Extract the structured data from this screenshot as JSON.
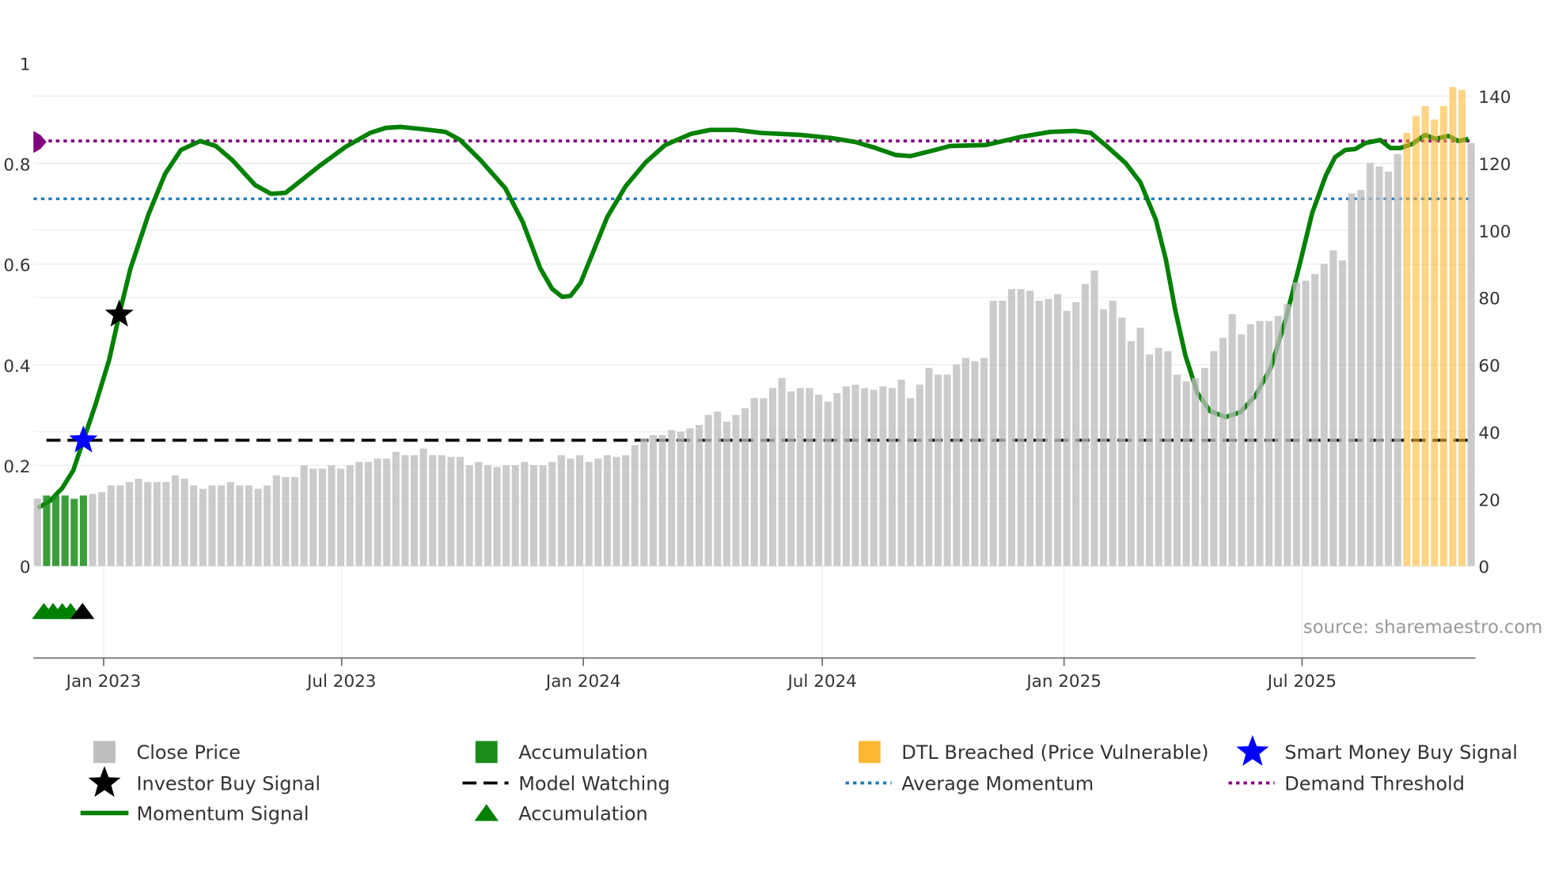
{
  "chart_data": {
    "type": "bar+line",
    "title": "",
    "x_unit": "week index",
    "x_ticks": [
      {
        "label": "Jan 2023",
        "week": 7.2
      },
      {
        "label": "Jul 2023",
        "week": 33.1
      },
      {
        "label": "Jan 2024",
        "week": 59.4
      },
      {
        "label": "Jul 2024",
        "week": 85.4
      },
      {
        "label": "Jan 2025",
        "week": 111.7
      },
      {
        "label": "Jul 2025",
        "week": 137.6
      }
    ],
    "left_axis": {
      "ylim": [
        0,
        1
      ],
      "ticks": [
        "0",
        "0.2",
        "0.4",
        "0.6",
        "0.8",
        "1"
      ]
    },
    "right_axis": {
      "ylim": [
        0,
        140
      ],
      "ticks": [
        "0",
        "20",
        "40",
        "60",
        "80",
        "100",
        "120",
        "140"
      ]
    },
    "close_price": [
      20,
      21,
      21,
      21,
      20,
      21,
      21.5,
      22,
      24,
      24,
      25,
      26,
      25,
      25,
      25,
      27,
      26,
      24,
      23,
      24,
      24,
      25,
      24,
      24,
      23,
      24,
      27,
      26.5,
      26.5,
      30,
      29,
      29,
      30,
      29,
      30,
      31,
      31,
      32,
      32,
      34,
      33,
      33,
      35,
      33,
      33,
      32.5,
      32.5,
      30,
      31,
      30,
      29.5,
      30,
      30,
      31,
      30,
      30,
      31,
      33,
      32,
      33,
      31,
      32,
      33,
      32.5,
      33,
      36,
      38,
      39,
      39,
      40.5,
      40,
      41,
      42,
      45,
      46,
      43,
      45,
      47,
      50,
      50,
      53,
      56,
      52,
      53,
      53,
      51,
      49,
      51.5,
      53.5,
      54,
      53,
      52.5,
      53.5,
      53,
      55.5,
      50,
      54,
      59,
      57,
      57,
      60,
      62,
      61,
      62,
      79,
      79,
      82.5,
      82.5,
      82,
      79,
      79.5,
      81,
      76,
      78.6,
      84,
      88,
      76.5,
      79,
      74,
      67,
      71,
      63,
      65,
      64,
      57,
      55,
      56,
      59,
      64,
      68,
      75,
      69,
      72,
      73,
      73,
      74.5,
      78,
      84.5,
      85,
      87,
      90,
      94,
      91,
      111,
      112,
      120,
      119,
      117.5,
      122.7,
      129,
      134,
      137,
      133,
      137,
      142.7,
      141.8,
      126
    ],
    "accumulation_bar_weeks": [
      1,
      2,
      3,
      4,
      5
    ],
    "dtl_breached_weeks": [
      149,
      150,
      151,
      152,
      153,
      154,
      155
    ],
    "momentum_signal": [
      [
        0,
        0.115
      ],
      [
        1.4,
        0.13
      ],
      [
        2.7,
        0.155
      ],
      [
        3.9,
        0.19
      ],
      [
        5.0,
        0.25
      ],
      [
        6.3,
        0.32
      ],
      [
        7.8,
        0.41
      ],
      [
        8.9,
        0.5
      ],
      [
        10.1,
        0.59
      ],
      [
        12.1,
        0.7
      ],
      [
        13.9,
        0.78
      ],
      [
        15.6,
        0.827
      ],
      [
        17.7,
        0.845
      ],
      [
        19.4,
        0.835
      ],
      [
        21.2,
        0.807
      ],
      [
        23.7,
        0.757
      ],
      [
        25.4,
        0.74
      ],
      [
        27.0,
        0.742
      ],
      [
        28.6,
        0.765
      ],
      [
        30.8,
        0.797
      ],
      [
        33.5,
        0.833
      ],
      [
        36.2,
        0.861
      ],
      [
        37.9,
        0.871
      ],
      [
        39.5,
        0.873
      ],
      [
        41.7,
        0.869
      ],
      [
        44.4,
        0.863
      ],
      [
        46.0,
        0.847
      ],
      [
        48.2,
        0.807
      ],
      [
        50.9,
        0.751
      ],
      [
        52.8,
        0.684
      ],
      [
        54.7,
        0.592
      ],
      [
        56.0,
        0.551
      ],
      [
        57.1,
        0.535
      ],
      [
        58.0,
        0.537
      ],
      [
        59.1,
        0.563
      ],
      [
        60.5,
        0.626
      ],
      [
        62.0,
        0.694
      ],
      [
        64.0,
        0.755
      ],
      [
        66.2,
        0.803
      ],
      [
        68.3,
        0.837
      ],
      [
        71.1,
        0.859
      ],
      [
        73.2,
        0.867
      ],
      [
        76.0,
        0.867
      ],
      [
        78.7,
        0.861
      ],
      [
        83.0,
        0.857
      ],
      [
        86.3,
        0.851
      ],
      [
        89.0,
        0.843
      ],
      [
        91.2,
        0.831
      ],
      [
        93.4,
        0.817
      ],
      [
        95.0,
        0.815
      ],
      [
        97.2,
        0.825
      ],
      [
        99.3,
        0.835
      ],
      [
        103.2,
        0.837
      ],
      [
        107.0,
        0.853
      ],
      [
        110.2,
        0.863
      ],
      [
        112.9,
        0.865
      ],
      [
        114.6,
        0.861
      ],
      [
        116.2,
        0.837
      ],
      [
        118.4,
        0.801
      ],
      [
        120.0,
        0.763
      ],
      [
        121.7,
        0.688
      ],
      [
        122.8,
        0.608
      ],
      [
        123.8,
        0.509
      ],
      [
        124.9,
        0.419
      ],
      [
        126.2,
        0.344
      ],
      [
        127.6,
        0.308
      ],
      [
        129.3,
        0.296
      ],
      [
        130.9,
        0.306
      ],
      [
        132.5,
        0.338
      ],
      [
        134.2,
        0.394
      ],
      [
        135.8,
        0.489
      ],
      [
        137.4,
        0.604
      ],
      [
        138.7,
        0.702
      ],
      [
        140.2,
        0.777
      ],
      [
        141.2,
        0.813
      ],
      [
        142.3,
        0.827
      ],
      [
        143.4,
        0.829
      ],
      [
        144.5,
        0.841
      ],
      [
        146.1,
        0.847
      ],
      [
        147.2,
        0.831
      ],
      [
        148.3,
        0.831
      ],
      [
        149.6,
        0.839
      ],
      [
        151.0,
        0.857
      ],
      [
        152.1,
        0.849
      ],
      [
        153.5,
        0.855
      ],
      [
        154.6,
        0.845
      ],
      [
        155.7,
        0.849
      ]
    ],
    "demand_threshold": 0.845,
    "average_momentum": 0.73,
    "model_watching": 0.25,
    "smart_money_buy_signal": [
      [
        5.0,
        0.25
      ]
    ],
    "investor_buy_signal": [
      [
        8.9,
        0.5
      ]
    ],
    "accumulation_triangles": [
      0.7,
      1.7,
      2.7,
      3.6
    ],
    "investor_triangles": [
      4.9
    ],
    "legend": {
      "placement": "bottom",
      "items": [
        "Close Price",
        "Accumulation",
        "DTL Breached (Price Vulnerable)",
        "Smart Money Buy Signal",
        "Investor Buy Signal",
        "Model Watching",
        "Average Momentum",
        "Demand Threshold",
        "Momentum Signal",
        "Accumulation"
      ]
    },
    "source": "source: sharemaestro.com"
  },
  "colors": {
    "close_price": "#bdbdbd",
    "accumulation": "#1a8c1a",
    "dtl": "#ffb733",
    "momentum": "#008000",
    "smart_money": "#0000ff",
    "investor": "#000000",
    "average_momentum": "#1f77b4",
    "demand": "#800080"
  }
}
